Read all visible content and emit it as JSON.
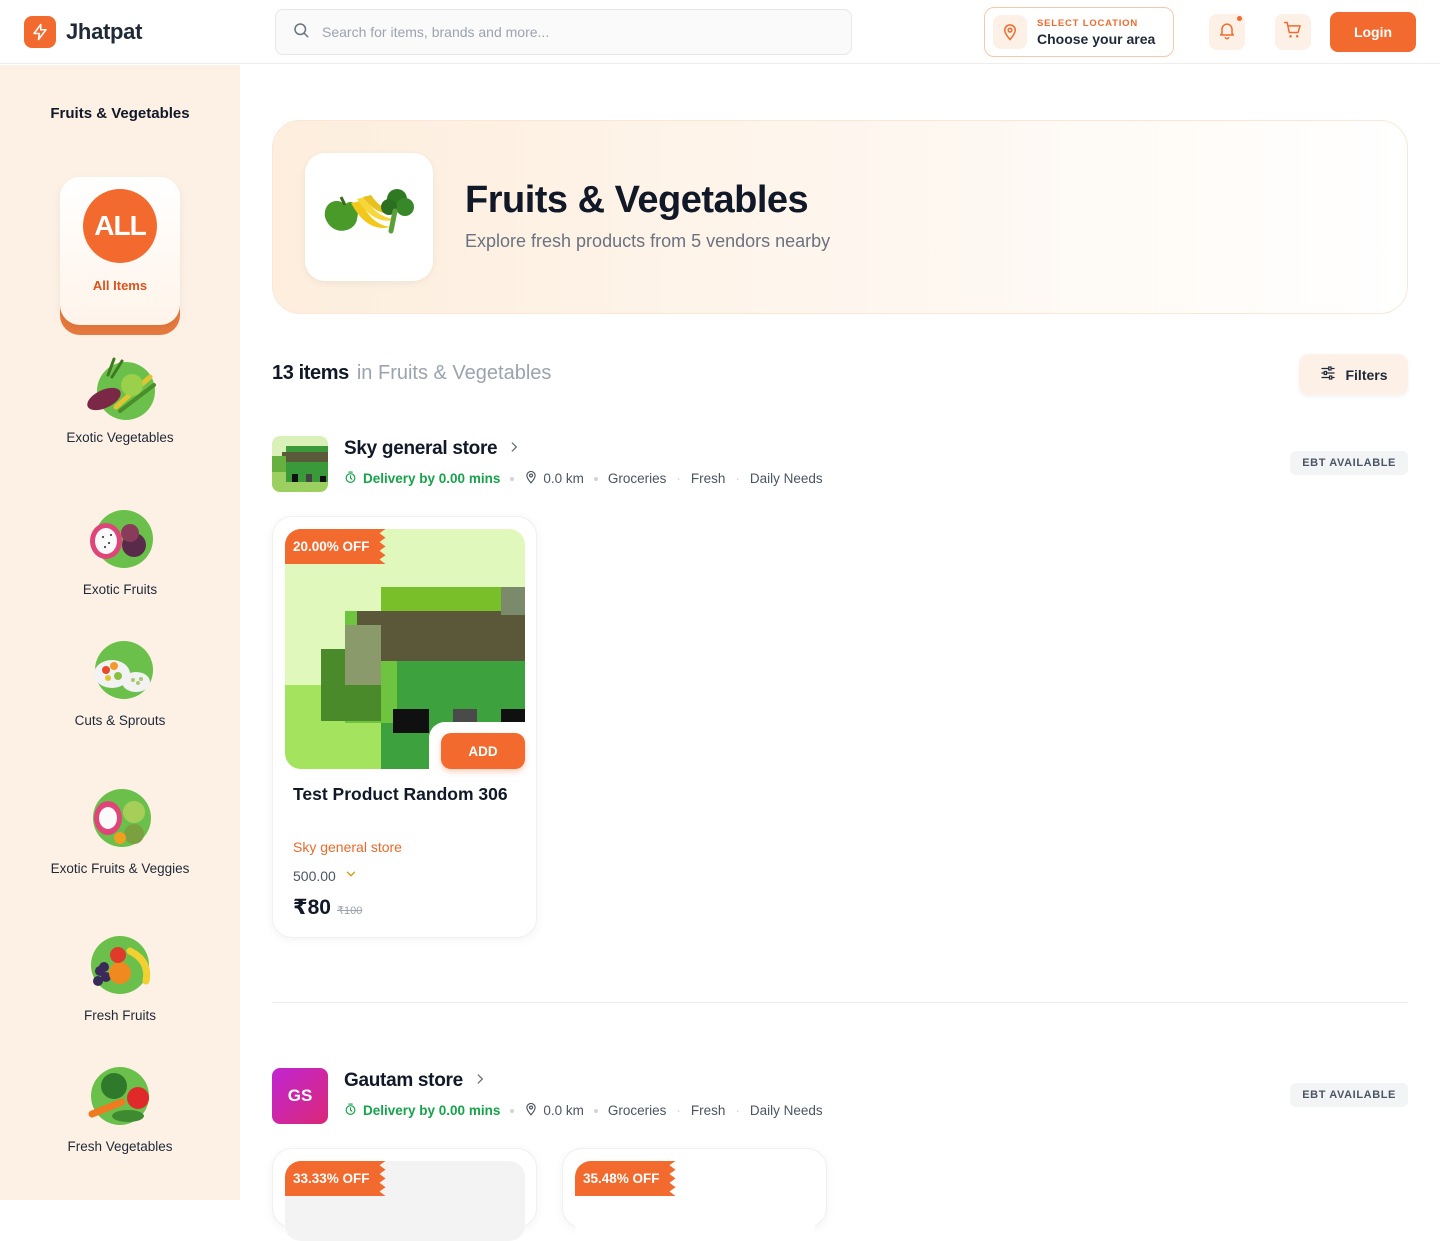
{
  "header": {
    "brand": "Jhatpat",
    "search_placeholder": "Search for items, brands and more...",
    "location_kicker": "SELECT LOCATION",
    "location_value": "Choose your area",
    "login_label": "Login",
    "accent_color": "#f26a2e"
  },
  "sidebar": {
    "title": "Fruits & Vegetables",
    "all_badge": "ALL",
    "all_label": "All Items",
    "items": [
      {
        "label": "Exotic Vegetables",
        "icon": "vegetables-icon"
      },
      {
        "label": "Exotic Fruits",
        "icon": "dragonfruit-icon"
      },
      {
        "label": "Cuts & Sprouts",
        "icon": "salad-icon"
      },
      {
        "label": "Exotic Fruits & Veggies",
        "icon": "mixed-produce-icon"
      },
      {
        "label": "Fresh Fruits",
        "icon": "fruits-icon"
      },
      {
        "label": "Fresh Vegetables",
        "icon": "fresh-vegetables-icon"
      }
    ]
  },
  "hero": {
    "title": "Fruits & Vegetables",
    "subtitle": "Explore fresh products from 5 vendors nearby"
  },
  "listing": {
    "count": "13 items",
    "context": "in Fruits & Vegetables",
    "filters_label": "Filters"
  },
  "vendors": [
    {
      "name": "Sky general store",
      "delivery": "Delivery by 0.00 mins",
      "distance": "0.0 km",
      "tags": [
        "Groceries",
        "Fresh",
        "Daily Needs"
      ],
      "badge": "EBT AVAILABLE",
      "products": [
        {
          "discount": "20.00% OFF",
          "name": "Test Product Random 306",
          "store": "Sky general store",
          "quantity": "500.00",
          "price": "80",
          "mrp": "₹100",
          "currency": "₹",
          "add_label": "ADD"
        }
      ]
    },
    {
      "name": "Gautam store",
      "initials": "GS",
      "delivery": "Delivery by 0.00 mins",
      "distance": "0.0 km",
      "tags": [
        "Groceries",
        "Fresh",
        "Daily Needs"
      ],
      "badge": "EBT AVAILABLE",
      "products": [
        {
          "discount": "33.33% OFF"
        },
        {
          "discount": "35.48% OFF"
        }
      ]
    }
  ]
}
